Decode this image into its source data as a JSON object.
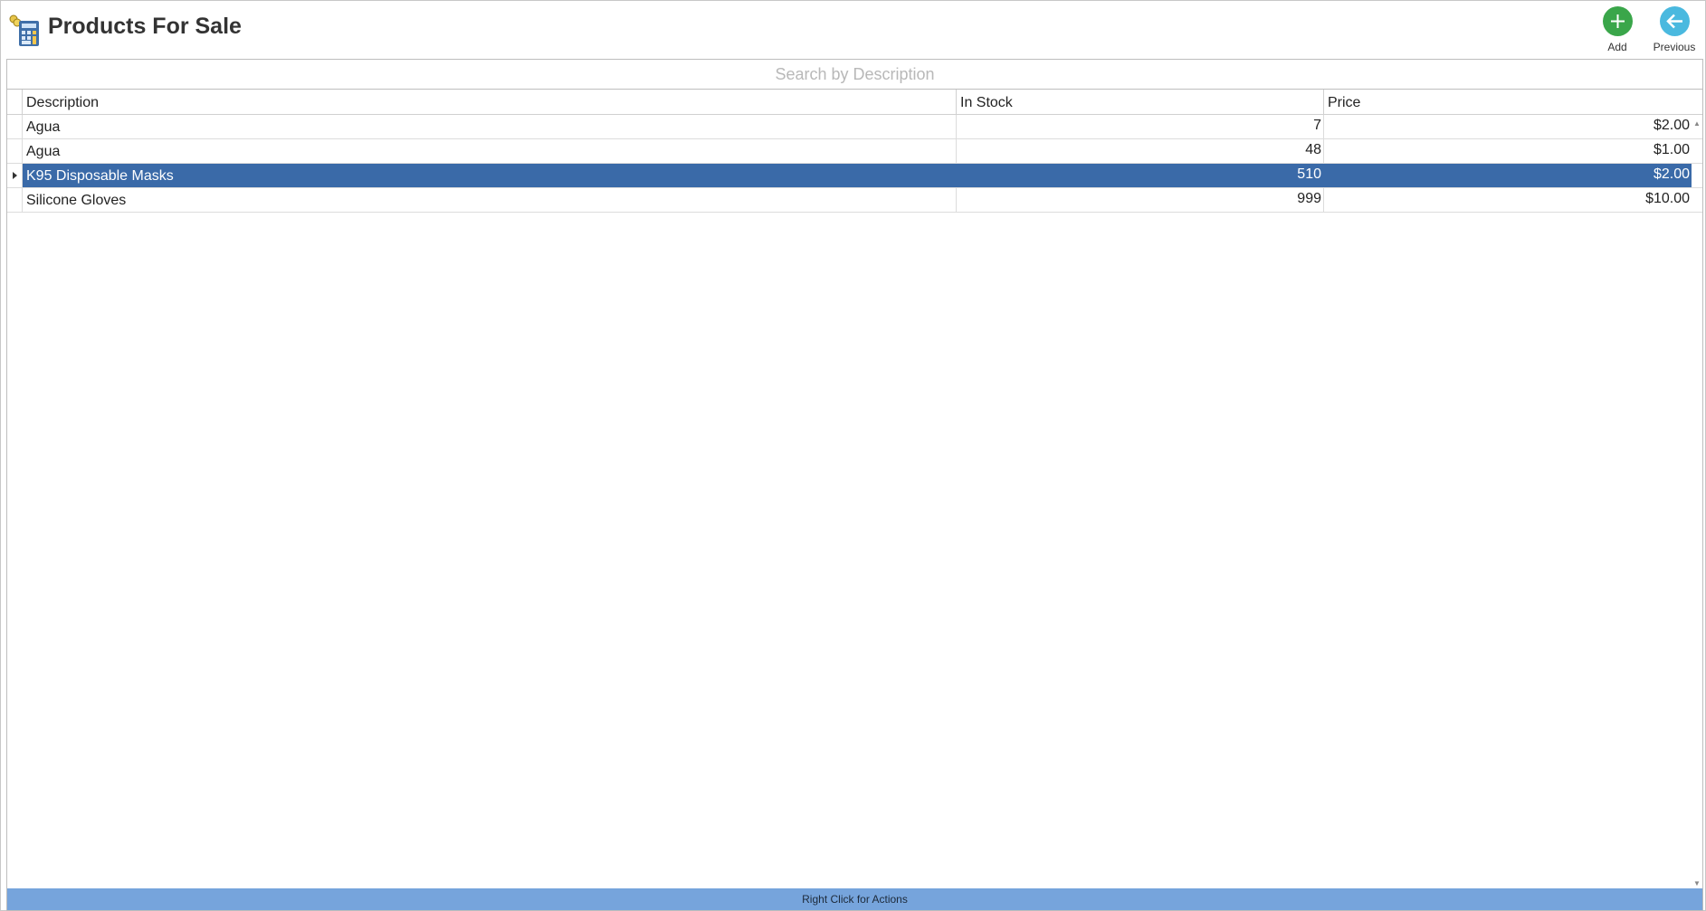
{
  "header": {
    "title": "Products For Sale",
    "app_icon": "calculator-coins-icon"
  },
  "toolbar": {
    "add_label": "Add",
    "add_icon": "plus-icon",
    "add_color": "#3aa64a",
    "previous_label": "Previous",
    "previous_icon": "arrow-left-icon",
    "previous_color": "#4ab9df"
  },
  "search": {
    "placeholder": "Search by Description",
    "value": ""
  },
  "table": {
    "columns": [
      "Description",
      "In Stock",
      "Price"
    ],
    "rows": [
      {
        "description": "Agua",
        "in_stock": "7",
        "price": "$2.00",
        "selected": false
      },
      {
        "description": "Agua",
        "in_stock": "48",
        "price": "$1.00",
        "selected": false
      },
      {
        "description": "K95 Disposable Masks",
        "in_stock": "510",
        "price": "$2.00",
        "selected": true
      },
      {
        "description": "Silicone Gloves",
        "in_stock": "999",
        "price": "$10.00",
        "selected": false
      }
    ],
    "selected_color": "#3a6aa8"
  },
  "status_bar": {
    "text": "Right Click for Actions",
    "color": "#76a4dc"
  }
}
